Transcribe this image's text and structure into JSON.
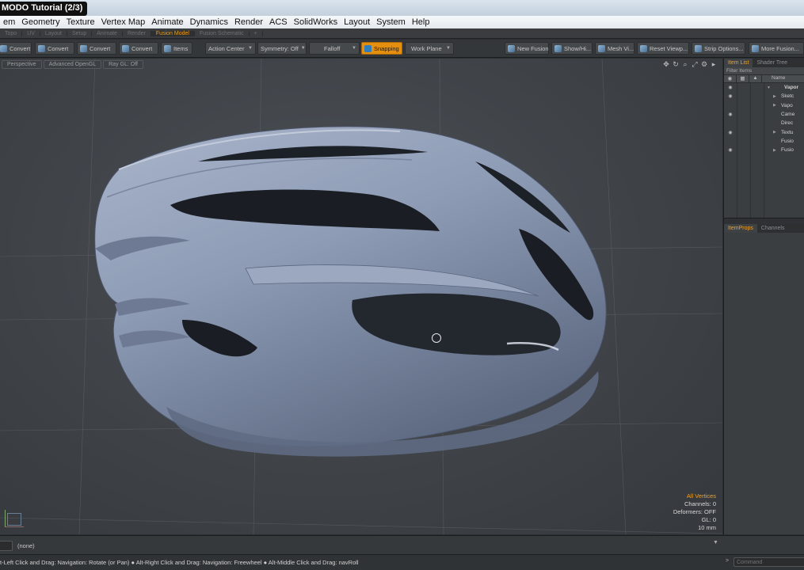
{
  "window": {
    "title": "MODO Tutorial (2/3)"
  },
  "menu": [
    "em",
    "Geometry",
    "Texture",
    "Vertex Map",
    "Animate",
    "Dynamics",
    "Render",
    "ACS",
    "SolidWorks",
    "Layout",
    "System",
    "Help"
  ],
  "layout_tabs": [
    {
      "label": "Topo",
      "active": false
    },
    {
      "label": "UV",
      "active": false
    },
    {
      "label": "Layout",
      "active": false
    },
    {
      "label": "Setup",
      "active": false
    },
    {
      "label": "Animate",
      "active": false
    },
    {
      "label": "Render",
      "active": false
    },
    {
      "label": "Fusion Model",
      "active": true
    },
    {
      "label": "Fusion Schematic",
      "active": false
    },
    {
      "label": "+",
      "active": false
    }
  ],
  "toolbar": {
    "convert1": "Convert",
    "convert2": "Convert",
    "convert3": "Convert",
    "convert4": "Convert",
    "items": "Items",
    "action_center": "Action Center",
    "symmetry": "Symmetry: Off",
    "falloff": "Falloff",
    "snapping": "Snapping",
    "work_plane": "Work Plane",
    "new_fusion": "New Fusion",
    "show_hide": "Show/Hi...",
    "mesh_vis": "Mesh Vi...",
    "reset_viewport": "Reset Viewp...",
    "strip_options": "Strip Options...",
    "more_fusion": "More Fusion..."
  },
  "viewport": {
    "view_mode": "Perspective",
    "renderer": "Advanced OpenGL",
    "ray_gl": "Ray GL: Off",
    "info": {
      "selection_mode": "All Vertices",
      "channels": "Channels: 0",
      "deformers": "Deformers: OFF",
      "gl": "GL: 0",
      "scale": "10 mm"
    }
  },
  "item_list": {
    "tabs": [
      "Item List",
      "Shader Tree"
    ],
    "filter_label": "Filter Items",
    "name_header": "Name",
    "items": [
      {
        "name": "Vapor",
        "visible": true
      },
      {
        "name": "Sketc",
        "visible": true
      },
      {
        "name": "Vapo",
        "visible": false
      },
      {
        "name": "Came",
        "visible": true
      },
      {
        "name": "Direc",
        "visible": false
      },
      {
        "name": "Textu",
        "visible": true
      },
      {
        "name": "Fusio",
        "visible": false
      },
      {
        "name": "Fusio",
        "visible": true
      }
    ]
  },
  "props_tabs": [
    "ItemProps",
    "Channels"
  ],
  "command_bar": {
    "value": "(none)"
  },
  "status": {
    "text": "t-Left Click and Drag: Navigation: Rotate (or Pan) ● Alt-Right Click and Drag: Navigation: Freewheel ● Alt-Middle Click and Drag: navRoll",
    "command_placeholder": "Command"
  },
  "colors": {
    "accent": "#f0a020",
    "helmet": "#8c9bb4",
    "viewport_bg": "#43474b"
  }
}
